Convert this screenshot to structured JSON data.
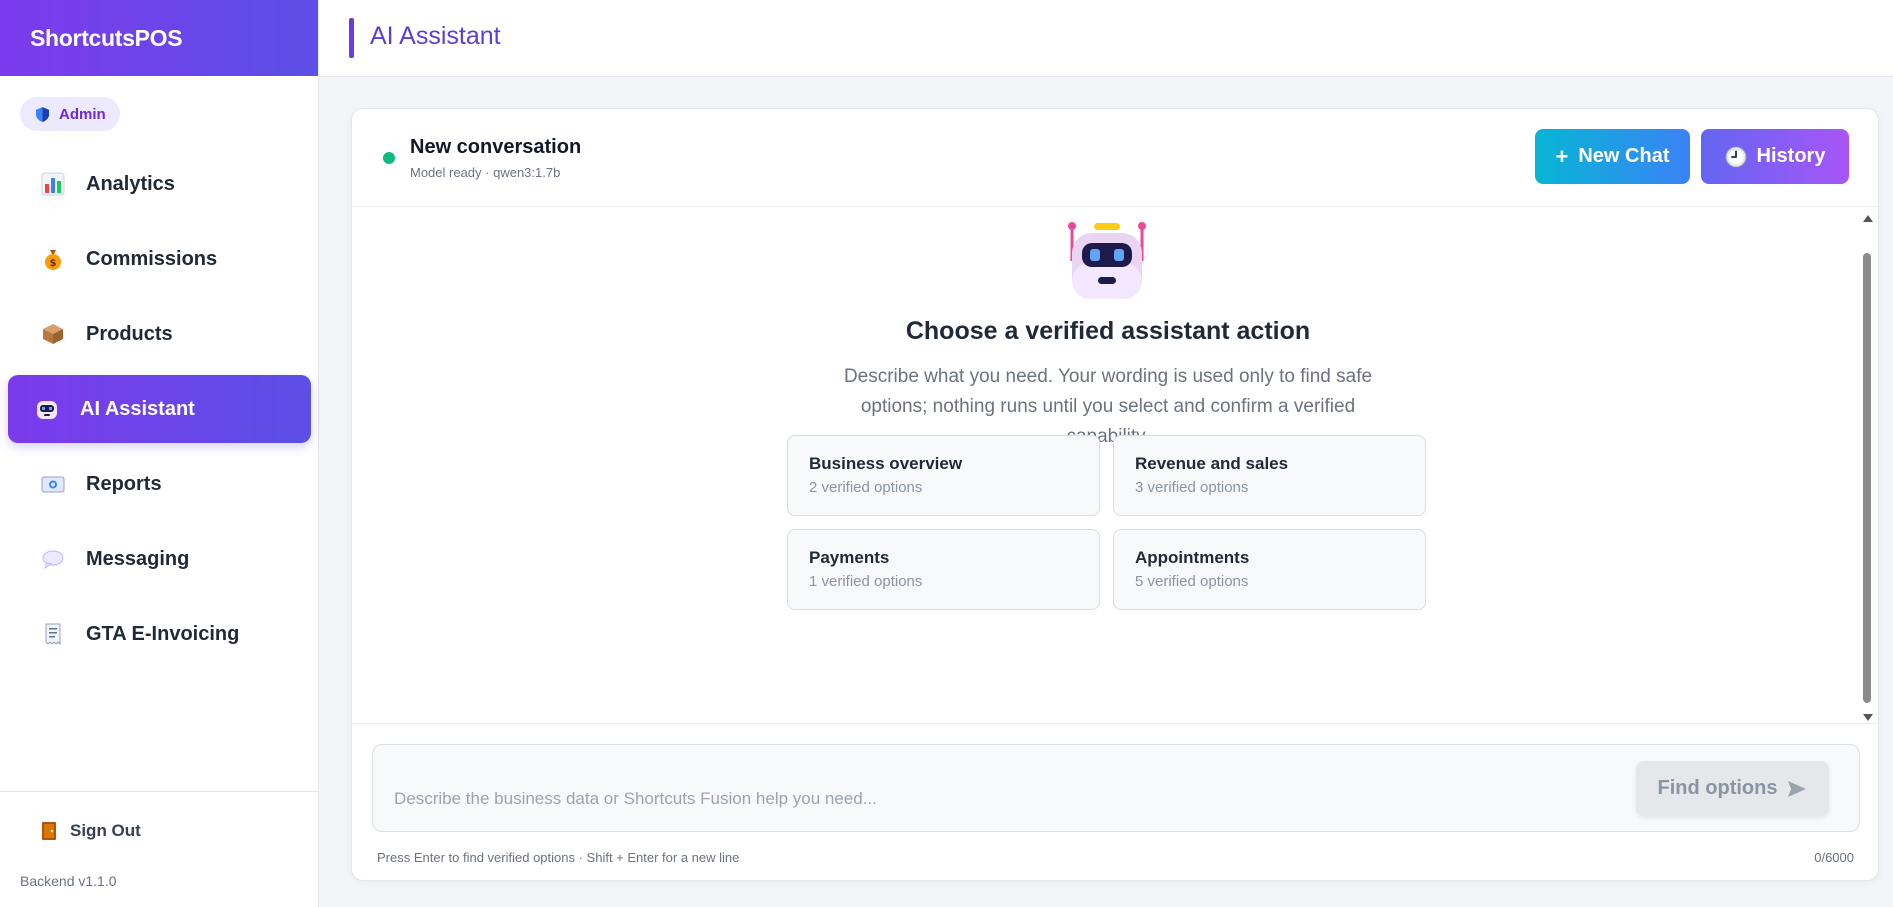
{
  "app": {
    "brand": "ShortcutsPOS",
    "role": "Admin",
    "version": "Backend v1.1.0"
  },
  "sidebar": {
    "items": [
      {
        "label": "Analytics",
        "icon": "bar-chart-icon"
      },
      {
        "label": "Commissions",
        "icon": "money-bag-icon"
      },
      {
        "label": "Products",
        "icon": "package-icon"
      },
      {
        "label": "AI Assistant",
        "icon": "robot-icon",
        "active": true
      },
      {
        "label": "Reports",
        "icon": "report-icon"
      },
      {
        "label": "Messaging",
        "icon": "speech-bubble-icon"
      },
      {
        "label": "GTA E-Invoicing",
        "icon": "receipt-icon"
      }
    ],
    "sign_out": "Sign Out"
  },
  "header": {
    "title": "AI Assistant"
  },
  "conversation": {
    "title": "New conversation",
    "subtitle": "Model ready · qwen3:1.7b",
    "new_chat": "New Chat",
    "history": "History"
  },
  "hero": {
    "title": "Choose a verified assistant action",
    "description": "Describe what you need. Your wording is used only to find safe options; nothing runs until you select and confirm a verified capability."
  },
  "options": [
    {
      "title": "Business overview",
      "count": "2 verified options"
    },
    {
      "title": "Revenue and sales",
      "count": "3 verified options"
    },
    {
      "title": "Payments",
      "count": "1 verified options"
    },
    {
      "title": "Appointments",
      "count": "5 verified options"
    }
  ],
  "composer": {
    "placeholder": "Describe the business data or Shortcuts Fusion help you need...",
    "button": "Find options",
    "hint": "Press Enter to find verified options · Shift + Enter for a new line",
    "counter": "0/6000"
  },
  "colors": {
    "accent": "#6d3ae8",
    "status_ready": "#10b981",
    "new_chat_gradient": [
      "#06b6d4",
      "#3b82f6"
    ],
    "history_gradient": [
      "#6366f1",
      "#a855f7"
    ]
  }
}
